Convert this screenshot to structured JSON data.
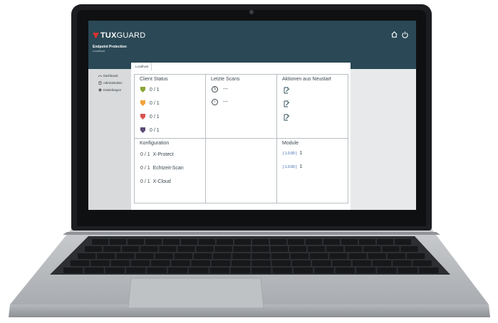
{
  "app": {
    "logo_bold": "TUX",
    "logo_thin": "GUARD",
    "product": "Endpoint Protection",
    "host": "Localhost",
    "header_icons": [
      "home-icon",
      "power-icon"
    ]
  },
  "sidebar": {
    "items": [
      {
        "label": "Dashboard",
        "icon": "dashboard-icon"
      },
      {
        "label": "Administration",
        "icon": "trash-icon"
      },
      {
        "label": "Einstellungen",
        "icon": "gear-icon"
      }
    ]
  },
  "tabs": [
    {
      "label": "Localhost"
    }
  ],
  "client_status": {
    "title": "Client Status",
    "rows": [
      {
        "value": "0 / 1",
        "color": "#8aa534"
      },
      {
        "value": "0 / 1",
        "color": "#f1a33a"
      },
      {
        "value": "0 / 1",
        "color": "#d8534d"
      },
      {
        "value": "0 / 1",
        "color": "#5b4b78"
      }
    ]
  },
  "letzte_scans": {
    "title": "Letzte Scans",
    "rows": [
      {
        "icon": "scan-clock-icon",
        "value": "---"
      },
      {
        "icon": "info-icon",
        "value": "---"
      }
    ]
  },
  "aktionen": {
    "title": "Aktionen aus Neustart",
    "icons": [
      "edit-doc-icon",
      "edit-doc-icon",
      "edit-doc-icon"
    ]
  },
  "konfiguration": {
    "title": "Konfiguration",
    "rows": [
      {
        "value": "0 / 1",
        "label": "X-Protect"
      },
      {
        "value": "0 / 1",
        "label": "Echtzeit-Scan"
      },
      {
        "value": "0 / 1",
        "label": "X-Cloud"
      }
    ]
  },
  "module": {
    "title": "Module",
    "rows": [
      {
        "badge": "1.0.00",
        "value": "1"
      },
      {
        "badge": "1.0.00",
        "value": "1"
      }
    ]
  },
  "colors": {
    "header": "#2a4855",
    "sidebar": "#d9dadb",
    "brand_red": "#d8322c"
  }
}
